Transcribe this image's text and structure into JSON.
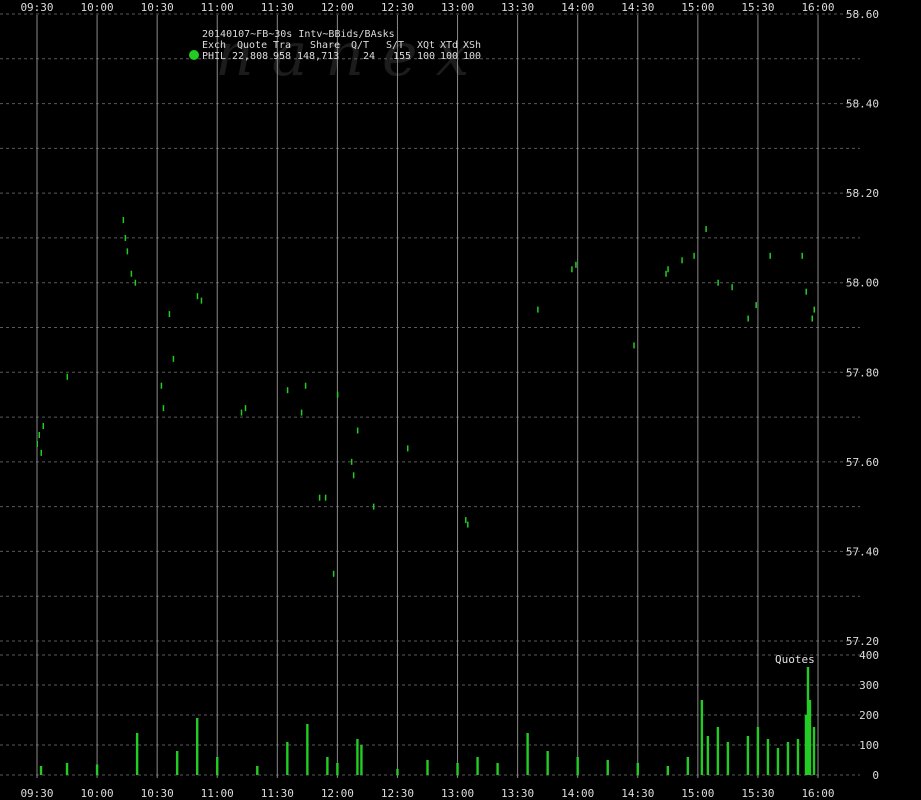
{
  "chart_data": {
    "type": "scatter",
    "title": "20140107~FB~30s Intv~BBids/BAsks",
    "watermark": "nanex",
    "x_ticks": [
      "09:30",
      "10:00",
      "10:30",
      "11:00",
      "11:30",
      "12:00",
      "12:30",
      "13:00",
      "13:30",
      "14:00",
      "14:30",
      "15:00",
      "15:30",
      "16:00"
    ],
    "price_ylim": [
      57.2,
      58.6
    ],
    "price_ticks": [
      "58.60",
      "58.40",
      "58.20",
      "58.00",
      "57.80",
      "57.60",
      "57.40",
      "57.20"
    ],
    "volume_label": "Quotes",
    "volume_ylim": [
      0,
      400
    ],
    "volume_ticks": [
      "400",
      "300",
      "200",
      "100",
      "0"
    ],
    "colors": {
      "series": "#22cc22",
      "grid": "#8a8a8a",
      "background": "#000000"
    },
    "legend": {
      "headers": [
        "Exch",
        "Quote",
        "Tra",
        "Share",
        "Q/T",
        "S/T",
        "XQt",
        "XTd",
        "XSh"
      ],
      "row": [
        "PHIL",
        "22,808",
        "958",
        "148,713",
        "24",
        "155",
        "100",
        "100",
        "100"
      ]
    },
    "price_series": [
      {
        "t": "09:30",
        "y": 57.64
      },
      {
        "t": "09:31",
        "y": 57.66
      },
      {
        "t": "09:32",
        "y": 57.62
      },
      {
        "t": "09:33",
        "y": 57.68
      },
      {
        "t": "09:45",
        "y": 57.79
      },
      {
        "t": "10:13",
        "y": 58.14
      },
      {
        "t": "10:14",
        "y": 58.1
      },
      {
        "t": "10:15",
        "y": 58.07
      },
      {
        "t": "10:17",
        "y": 58.02
      },
      {
        "t": "10:19",
        "y": 58.0
      },
      {
        "t": "10:32",
        "y": 57.77
      },
      {
        "t": "10:33",
        "y": 57.72
      },
      {
        "t": "10:36",
        "y": 57.93
      },
      {
        "t": "10:38",
        "y": 57.83
      },
      {
        "t": "10:50",
        "y": 57.97
      },
      {
        "t": "10:52",
        "y": 57.96
      },
      {
        "t": "11:12",
        "y": 57.71
      },
      {
        "t": "11:14",
        "y": 57.72
      },
      {
        "t": "11:35",
        "y": 57.76
      },
      {
        "t": "11:42",
        "y": 57.71
      },
      {
        "t": "11:44",
        "y": 57.77
      },
      {
        "t": "11:51",
        "y": 57.52
      },
      {
        "t": "11:54",
        "y": 57.52
      },
      {
        "t": "11:58",
        "y": 57.35
      },
      {
        "t": "12:00",
        "y": 57.75
      },
      {
        "t": "12:07",
        "y": 57.6
      },
      {
        "t": "12:08",
        "y": 57.57
      },
      {
        "t": "12:10",
        "y": 57.67
      },
      {
        "t": "12:18",
        "y": 57.5
      },
      {
        "t": "12:35",
        "y": 57.63
      },
      {
        "t": "13:04",
        "y": 57.47
      },
      {
        "t": "13:05",
        "y": 57.46
      },
      {
        "t": "13:40",
        "y": 57.94
      },
      {
        "t": "13:57",
        "y": 58.03
      },
      {
        "t": "13:59",
        "y": 58.04
      },
      {
        "t": "14:28",
        "y": 57.86
      },
      {
        "t": "14:44",
        "y": 58.02
      },
      {
        "t": "14:45",
        "y": 58.03
      },
      {
        "t": "14:52",
        "y": 58.05
      },
      {
        "t": "14:58",
        "y": 58.06
      },
      {
        "t": "15:04",
        "y": 58.12
      },
      {
        "t": "15:10",
        "y": 58.0
      },
      {
        "t": "15:17",
        "y": 57.99
      },
      {
        "t": "15:25",
        "y": 57.92
      },
      {
        "t": "15:29",
        "y": 57.95
      },
      {
        "t": "15:36",
        "y": 58.06
      },
      {
        "t": "15:52",
        "y": 58.06
      },
      {
        "t": "15:54",
        "y": 57.98
      },
      {
        "t": "15:57",
        "y": 57.92
      },
      {
        "t": "15:58",
        "y": 57.94
      }
    ],
    "quote_volume": [
      {
        "t": "09:32",
        "v": 30
      },
      {
        "t": "09:45",
        "v": 40
      },
      {
        "t": "10:00",
        "v": 35
      },
      {
        "t": "10:20",
        "v": 140
      },
      {
        "t": "10:40",
        "v": 80
      },
      {
        "t": "10:50",
        "v": 190
      },
      {
        "t": "11:00",
        "v": 60
      },
      {
        "t": "11:20",
        "v": 30
      },
      {
        "t": "11:35",
        "v": 110
      },
      {
        "t": "11:45",
        "v": 170
      },
      {
        "t": "11:55",
        "v": 60
      },
      {
        "t": "12:00",
        "v": 40
      },
      {
        "t": "12:10",
        "v": 120
      },
      {
        "t": "12:12",
        "v": 100
      },
      {
        "t": "12:30",
        "v": 20
      },
      {
        "t": "12:45",
        "v": 50
      },
      {
        "t": "13:00",
        "v": 40
      },
      {
        "t": "13:10",
        "v": 60
      },
      {
        "t": "13:20",
        "v": 40
      },
      {
        "t": "13:35",
        "v": 140
      },
      {
        "t": "13:45",
        "v": 80
      },
      {
        "t": "14:00",
        "v": 60
      },
      {
        "t": "14:15",
        "v": 50
      },
      {
        "t": "14:30",
        "v": 40
      },
      {
        "t": "14:45",
        "v": 30
      },
      {
        "t": "14:55",
        "v": 60
      },
      {
        "t": "15:02",
        "v": 250
      },
      {
        "t": "15:05",
        "v": 130
      },
      {
        "t": "15:10",
        "v": 160
      },
      {
        "t": "15:15",
        "v": 110
      },
      {
        "t": "15:25",
        "v": 130
      },
      {
        "t": "15:30",
        "v": 160
      },
      {
        "t": "15:35",
        "v": 120
      },
      {
        "t": "15:40",
        "v": 90
      },
      {
        "t": "15:45",
        "v": 110
      },
      {
        "t": "15:50",
        "v": 120
      },
      {
        "t": "15:54",
        "v": 200
      },
      {
        "t": "15:55",
        "v": 360
      },
      {
        "t": "15:56",
        "v": 250
      },
      {
        "t": "15:58",
        "v": 160
      }
    ]
  }
}
